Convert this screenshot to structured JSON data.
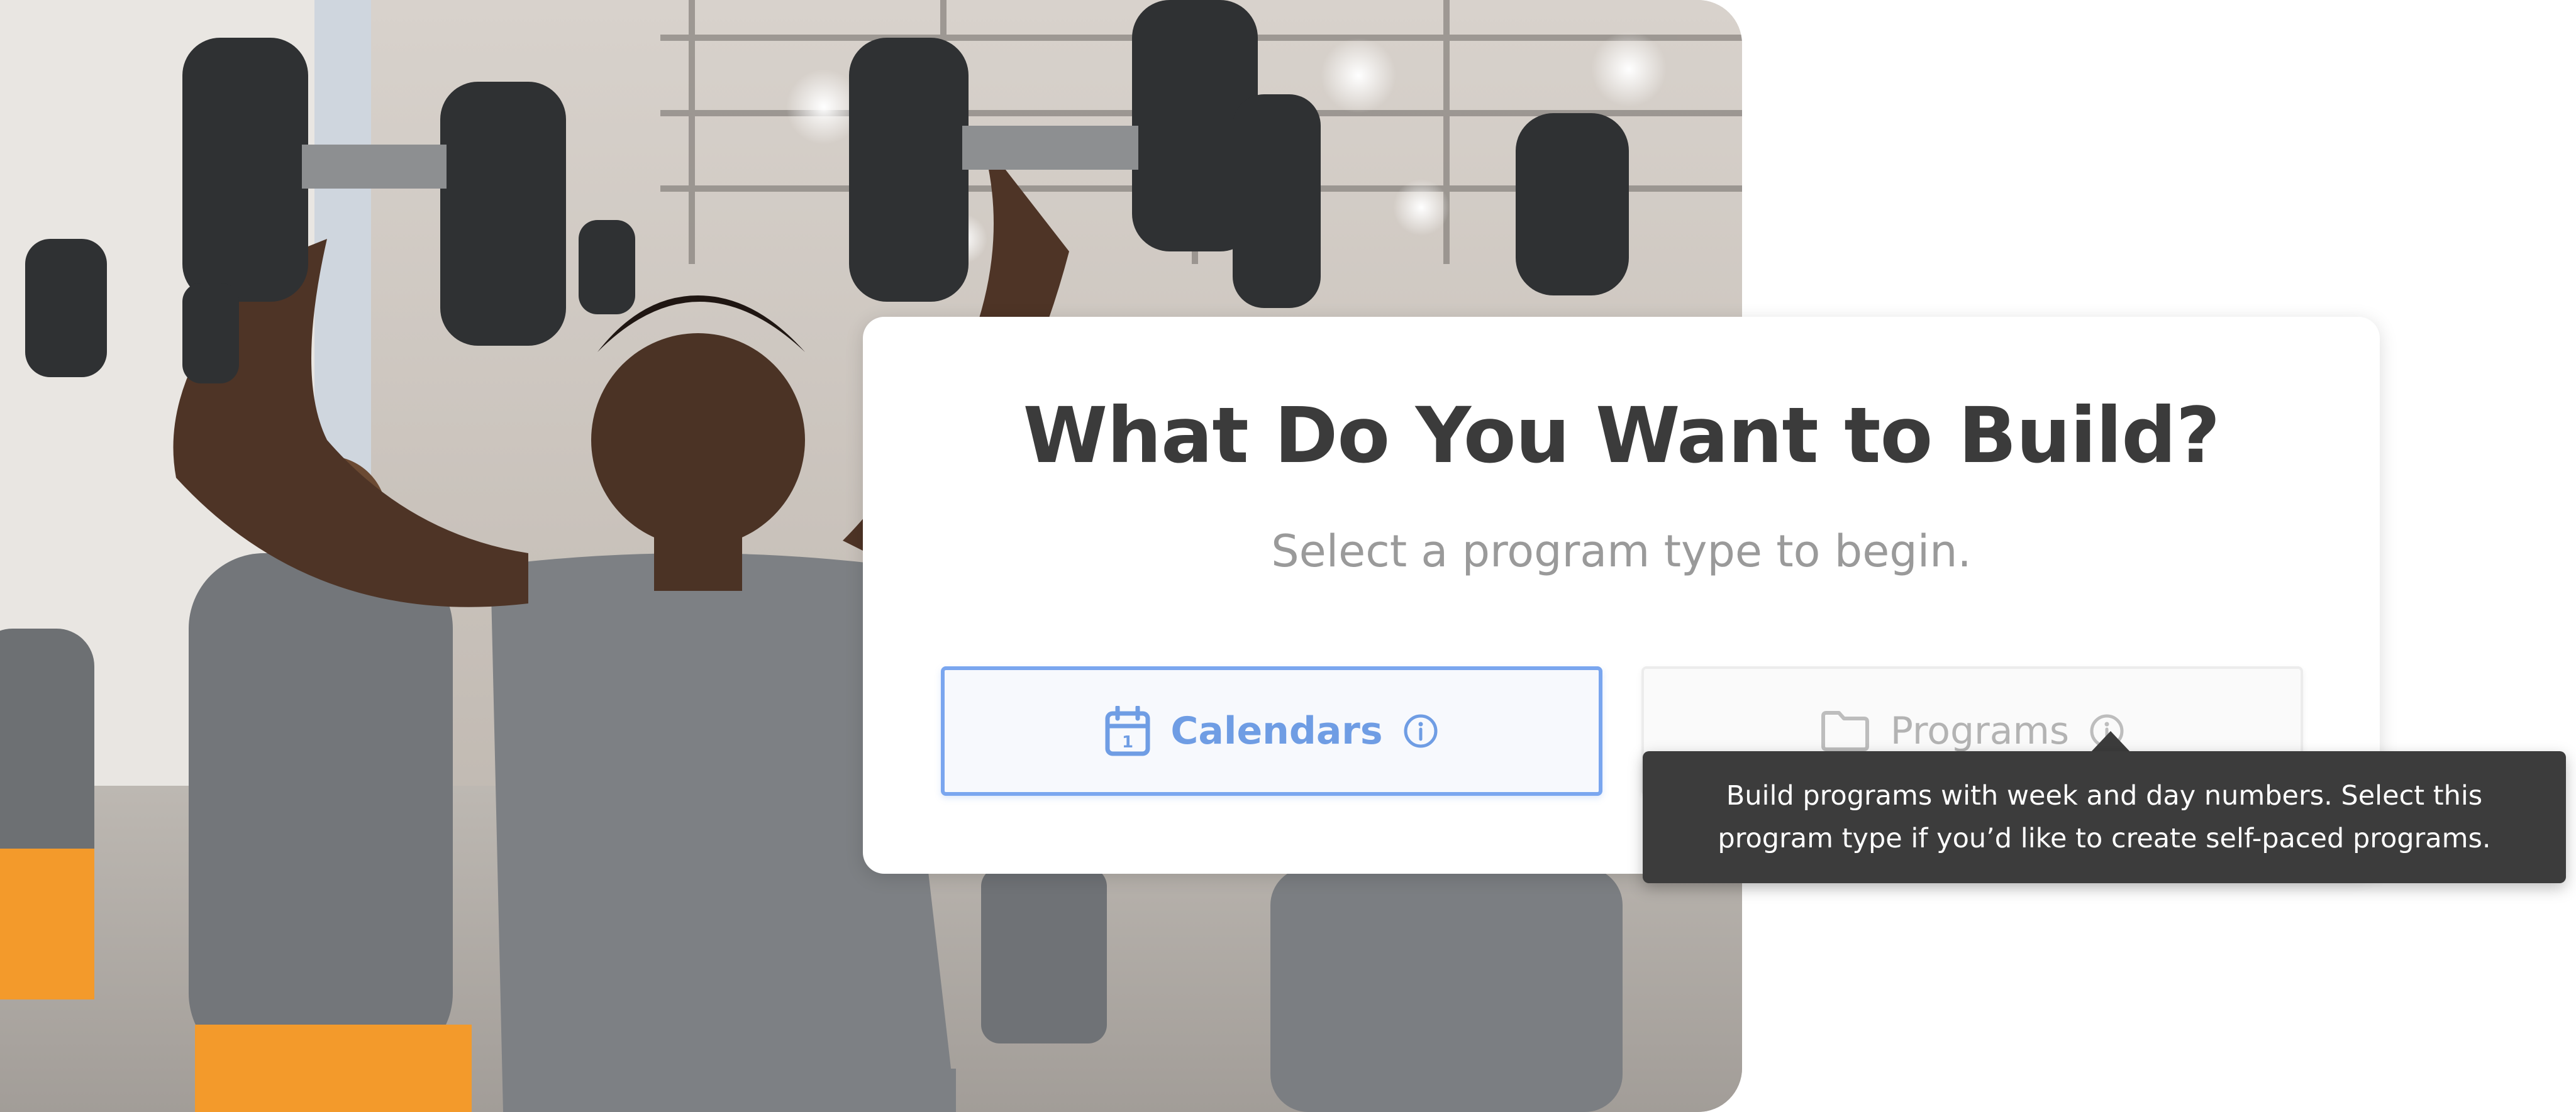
{
  "dialog": {
    "title": "What Do You Want to Build?",
    "subtitle": "Select a program type to begin."
  },
  "options": [
    {
      "label": "Calendars",
      "icon": "calendar-icon",
      "state": "selected",
      "color": "#6f9de4"
    },
    {
      "label": "Programs",
      "icon": "folder-icon",
      "state": "unselected",
      "color": "#b3b3b3"
    }
  ],
  "info_icon": "info-icon",
  "calendar_icon_day": "1",
  "tooltip": {
    "text": "Build programs with week and day numbers. Select this program type if you’d like to create self-paced programs."
  },
  "colors": {
    "accent": "#7aa6ef",
    "title": "#3b3b3b",
    "subtitle": "#9a9a9a",
    "tooltip_bg": "#3c3c3c"
  }
}
